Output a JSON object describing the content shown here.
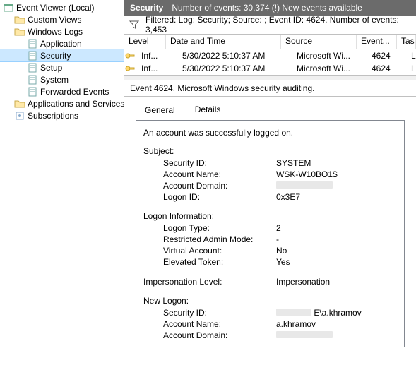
{
  "tree": {
    "root": "Event Viewer (Local)",
    "custom_views": "Custom Views",
    "windows_logs": "Windows Logs",
    "application": "Application",
    "security": "Security",
    "setup": "Setup",
    "system": "System",
    "forwarded": "Forwarded Events",
    "apps_svc": "Applications and Services Lo",
    "subscriptions": "Subscriptions"
  },
  "header": {
    "title": "Security",
    "count_label": "Number of events: 30,374 (!) New events available"
  },
  "filter": {
    "text": "Filtered: Log: Security; Source: ; Event ID: 4624. Number of events: 3,453"
  },
  "columns": {
    "level": "Level",
    "date": "Date and Time",
    "source": "Source",
    "event": "Event...",
    "task": "Task Ca"
  },
  "rows": [
    {
      "level": "Inf...",
      "date": "5/30/2022 5:10:37 AM",
      "source": "Microsoft Wi...",
      "event": "4624",
      "task": "Logon"
    },
    {
      "level": "Inf...",
      "date": "5/30/2022 5:10:37 AM",
      "source": "Microsoft Wi...",
      "event": "4624",
      "task": "Logon"
    }
  ],
  "detail": {
    "title": "Event 4624, Microsoft Windows security auditing.",
    "tabs": {
      "general": "General",
      "details": "Details"
    },
    "summary": "An account was successfully logged on.",
    "subject": {
      "label": "Subject:",
      "security_id_k": "Security ID:",
      "security_id_v": "SYSTEM",
      "acct_name_k": "Account Name:",
      "acct_name_v": "WSK-W10BO1$",
      "acct_dom_k": "Account Domain:",
      "acct_dom_v": "",
      "logon_id_k": "Logon ID:",
      "logon_id_v": "0x3E7"
    },
    "logon_info": {
      "label": "Logon Information:",
      "type_k": "Logon Type:",
      "type_v": "2",
      "ram_k": "Restricted Admin Mode:",
      "ram_v": "-",
      "va_k": "Virtual Account:",
      "va_v": "No",
      "et_k": "Elevated Token:",
      "et_v": "Yes"
    },
    "imp": {
      "k": "Impersonation Level:",
      "v": "Impersonation"
    },
    "new_logon": {
      "label": "New Logon:",
      "sid_k": "Security ID:",
      "sid_v": "E\\a.khramov",
      "an_k": "Account Name:",
      "an_v": "a.khramov",
      "ad_k": "Account Domain:"
    }
  }
}
